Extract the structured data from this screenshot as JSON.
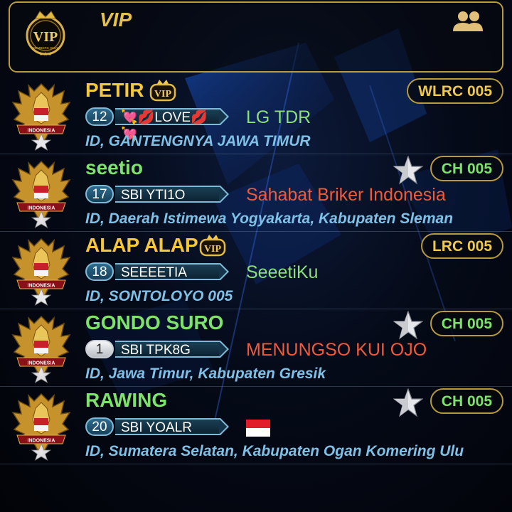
{
  "header": {
    "title": "VIP",
    "logo_text": "VIP",
    "logo_subtext": "MEMBERS ONLY"
  },
  "colors": {
    "gold": "#e7c24a",
    "room_green": "#7ee36a",
    "room_gold": "#f0c84a",
    "location_blue": "#7fc1e6",
    "status_green": "#8be07a",
    "status_red": "#f05a3a"
  },
  "avatar_text": "INDONESIA",
  "rows": [
    {
      "name": "PETIR",
      "name_color": "#f5c73a",
      "vip": true,
      "level": "12",
      "tag": "💘💋LOVE💋💘",
      "status": "LG TDR",
      "status_color": "#8be07a",
      "location": "ID, GANTENGNYA JAWA TIMUR",
      "room": "WLRC 005",
      "room_color": "#f0c84a",
      "star": false
    },
    {
      "name": "seetio",
      "name_color": "#7ee36a",
      "vip": false,
      "level": "17",
      "tag": "SBI YTI1O",
      "status": "Sahabat Briker Indonesia",
      "status_color": "#f05a3a",
      "location": "ID, Daerah Istimewa Yogyakarta, Kabupaten Sleman",
      "room": "CH 005",
      "room_color": "#7ee36a",
      "star": true
    },
    {
      "name": "ALAP ALAP",
      "name_color": "#f5c73a",
      "vip": true,
      "level": "18",
      "tag": "SEEEETIA",
      "status": "SeeetiKu",
      "status_color": "#8be07a",
      "location": "ID, SONTOLOYO 005",
      "room": "LRC 005",
      "room_color": "#f0c84a",
      "star": false
    },
    {
      "name": "GONDO SURO",
      "name_color": "#7ee36a",
      "vip": false,
      "level": "1",
      "tag": "SBI TPK8G",
      "status": "MENUNGSO KUI OJO",
      "status_color": "#f05a3a",
      "location": "ID, Jawa Timur, Kabupaten Gresik",
      "room": "CH 005",
      "room_color": "#7ee36a",
      "star": true
    },
    {
      "name": "RAWING",
      "name_color": "#7ee36a",
      "vip": false,
      "level": "20",
      "tag": "SBI YOALR",
      "status": "",
      "status_icon": "indonesia-flag-icon",
      "status_color": "#8be07a",
      "location": "ID, Sumatera Selatan, Kabupaten Ogan Komering Ulu",
      "room": "CH 005",
      "room_color": "#7ee36a",
      "star": true
    }
  ]
}
